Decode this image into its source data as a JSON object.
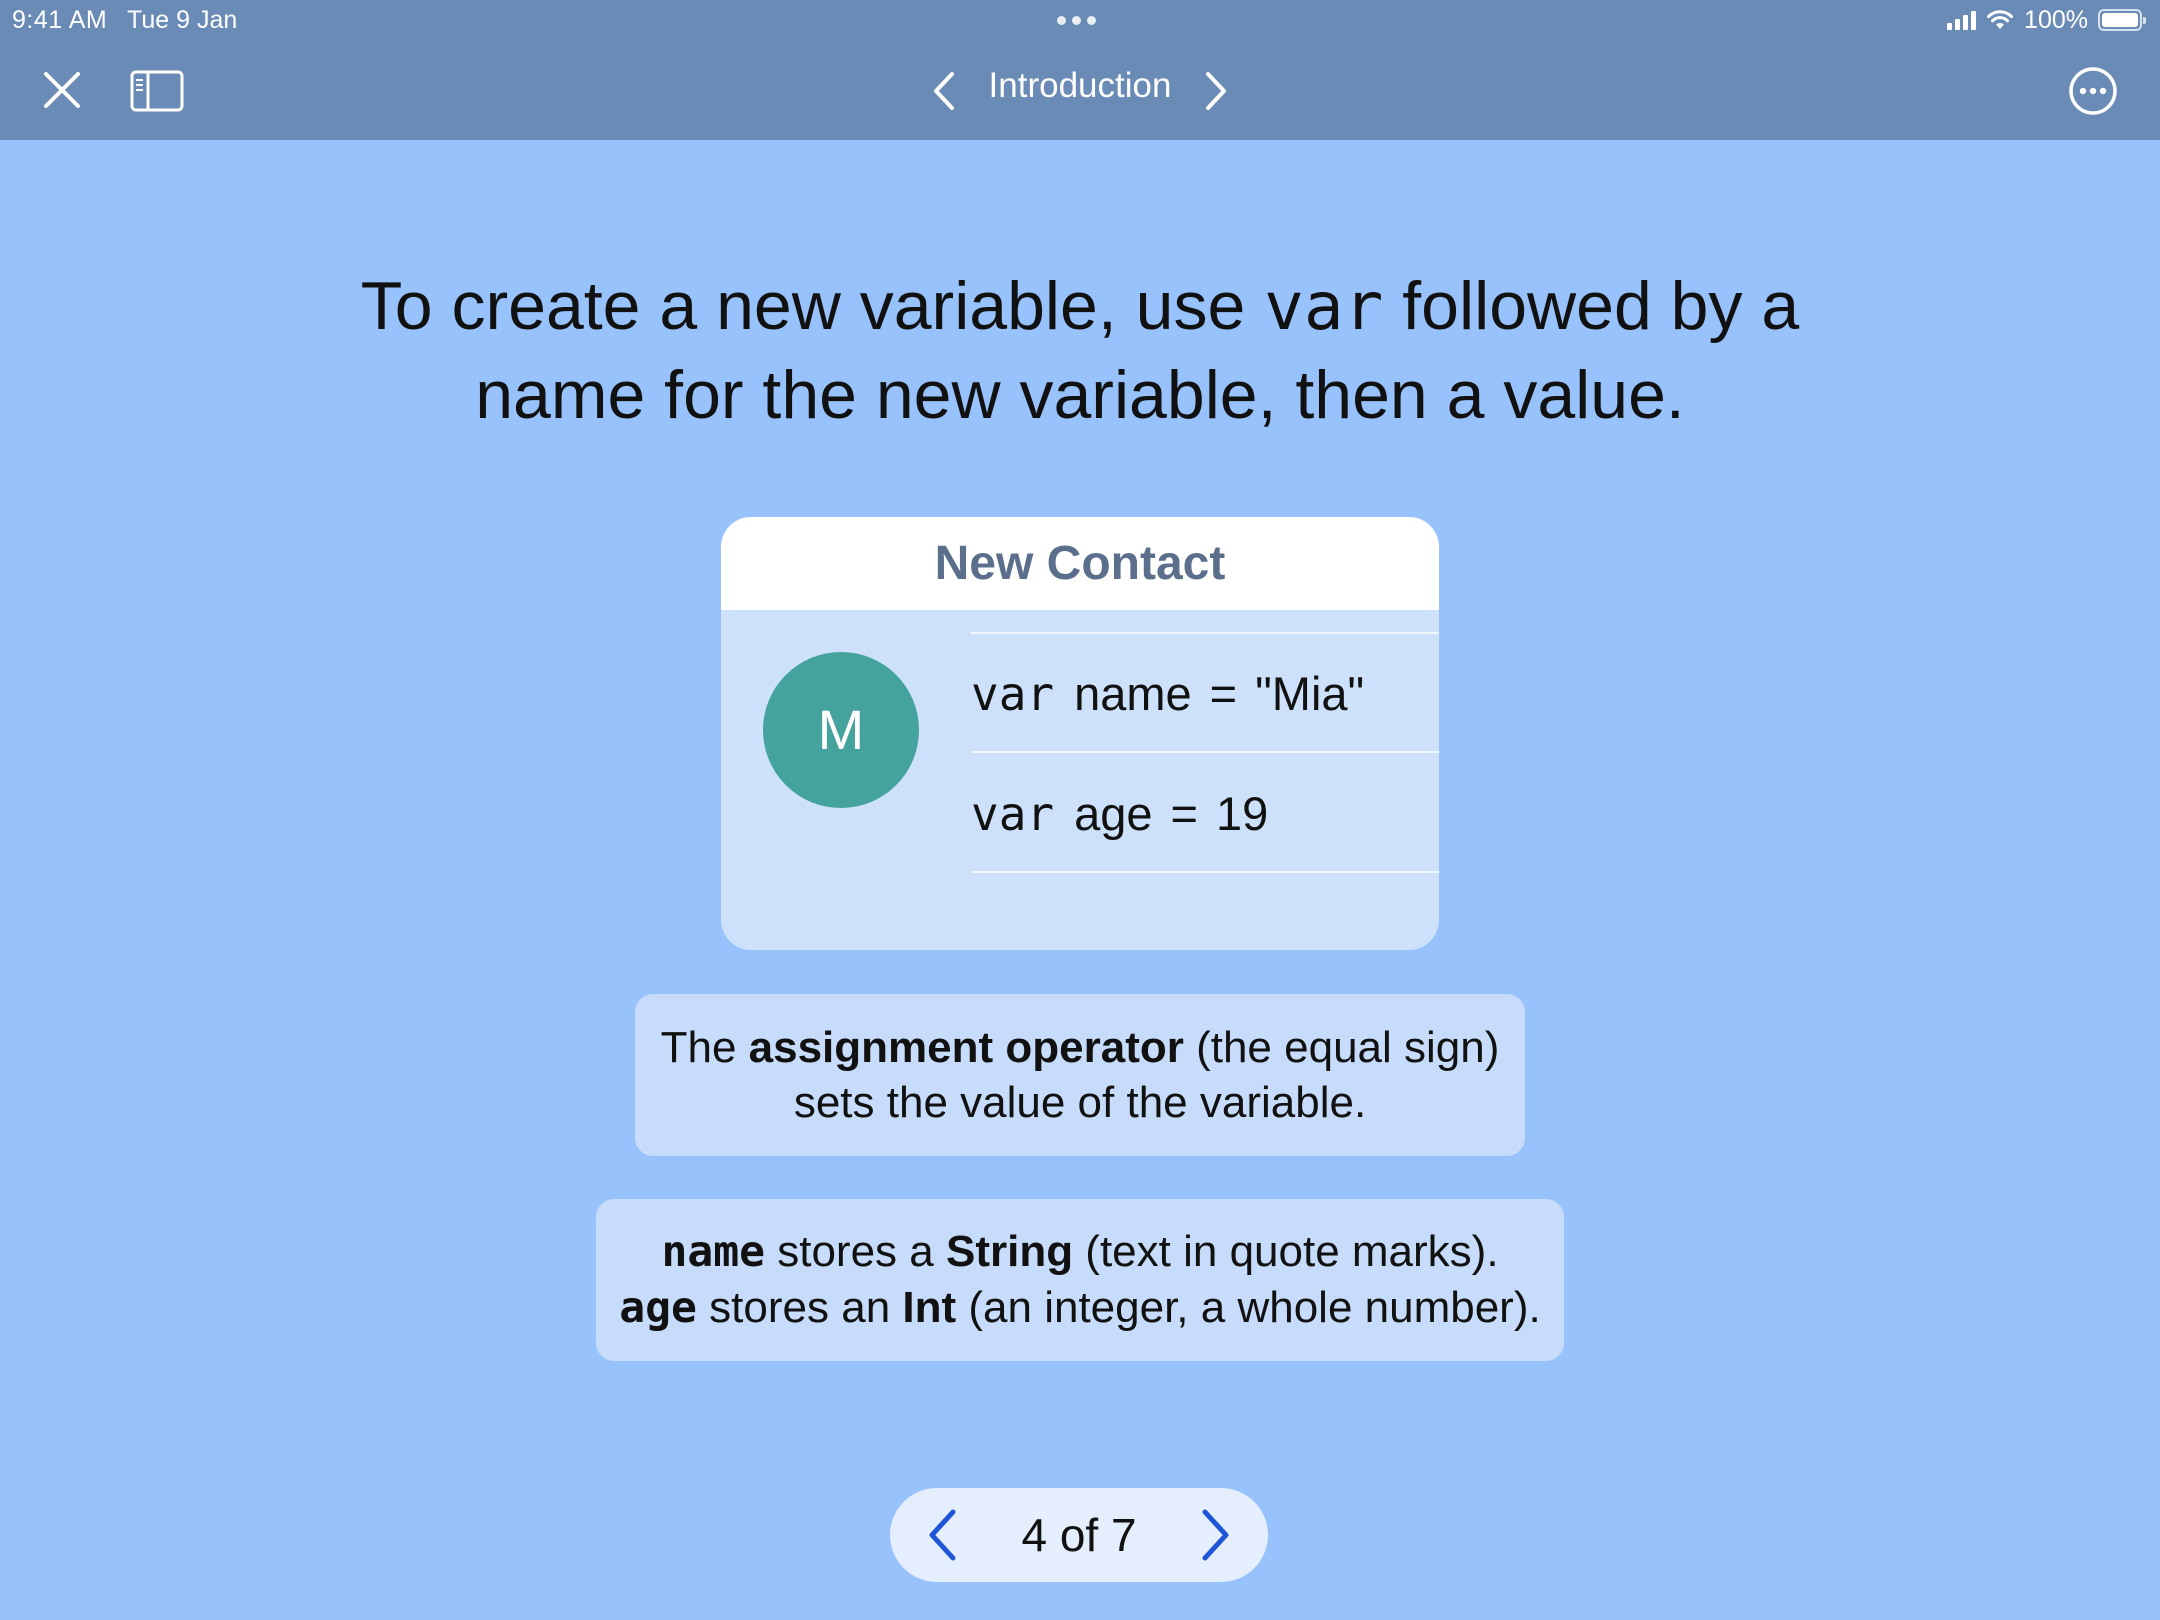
{
  "status_bar": {
    "time": "9:41 AM",
    "date": "Tue 9 Jan",
    "battery_label": "100%"
  },
  "nav": {
    "title": "Introduction",
    "icons": [
      "close-icon",
      "sidebar-icon",
      "chevron-left-icon",
      "chevron-right-icon",
      "more-icon"
    ],
    "accent": "#ffffff"
  },
  "headline": {
    "before": "To create a new variable, use ",
    "code": "var",
    "after": " followed by a name for the new variable, then a value."
  },
  "contact_card": {
    "title": "New Contact",
    "avatar_initial": "M",
    "avatar_color": "#45a39d",
    "fields": [
      {
        "keyword": "var",
        "name": "name",
        "operator": "=",
        "value": "\"Mia\""
      },
      {
        "keyword": "var",
        "name": "age",
        "operator": "=",
        "value": "19"
      }
    ]
  },
  "note1": {
    "prefix": "The ",
    "bold": "assignment operator",
    "rest1": " (the equal sign)",
    "line2": "sets the value of the variable."
  },
  "note2": {
    "line1": {
      "code": "name",
      "mid": " stores a ",
      "bold": "String",
      "rest": " (text in quote marks)."
    },
    "line2": {
      "code": "age",
      "mid": " stores an ",
      "bold": "Int",
      "rest": " (an integer, a whole number)."
    }
  },
  "pager": {
    "label": "4 of 7",
    "accent": "#1f56d6"
  },
  "colors": {
    "background": "#98c2fc",
    "topbar": "#6a8bb6"
  }
}
